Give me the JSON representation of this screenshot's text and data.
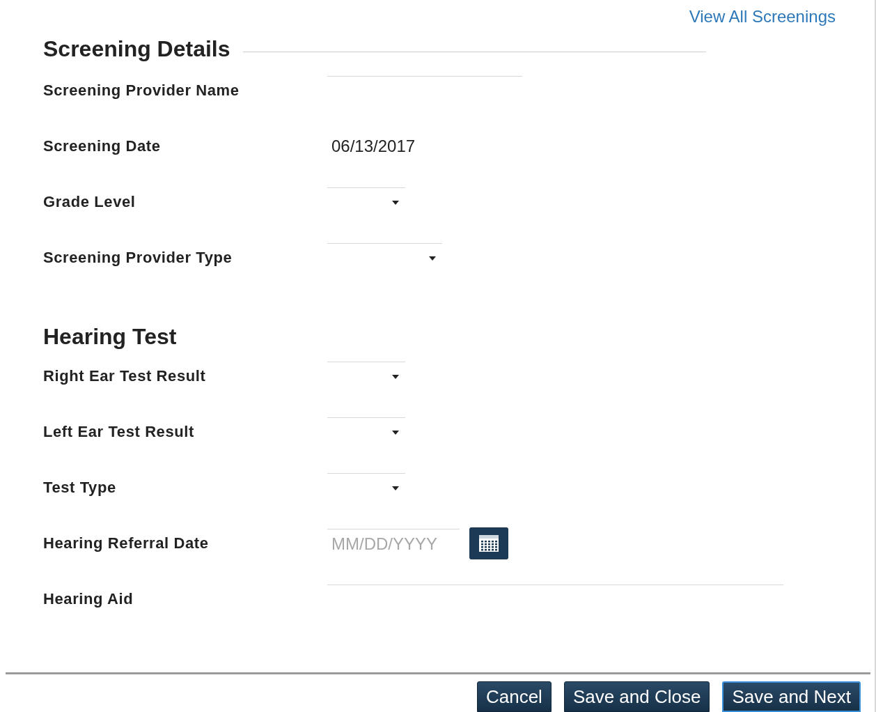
{
  "header_link": "View All Screenings",
  "sections": [
    {
      "title": "Screening Details",
      "divider": true,
      "fields": [
        {
          "label": "Screening Provider Name",
          "kind": "text"
        },
        {
          "label": "Screening Date",
          "kind": "static",
          "value": "06/13/2017"
        },
        {
          "label": "Grade Level",
          "kind": "select"
        },
        {
          "label": "Screening Provider Type",
          "kind": "select"
        }
      ]
    },
    {
      "title": "Hearing Test",
      "divider": false,
      "fields": [
        {
          "label": "Right Ear Test Result",
          "kind": "select"
        },
        {
          "label": "Left Ear Test Result",
          "kind": "select"
        },
        {
          "label": "Test Type",
          "kind": "select"
        },
        {
          "label": "Hearing Referral Date",
          "kind": "date",
          "placeholder": "MM/DD/YYYY"
        },
        {
          "label": "Hearing Aid",
          "kind": "textarea"
        }
      ]
    }
  ],
  "buttons": [
    {
      "label": "Cancel",
      "focused": false
    },
    {
      "label": "Save and Close",
      "focused": false
    },
    {
      "label": "Save and Next",
      "focused": true
    }
  ]
}
